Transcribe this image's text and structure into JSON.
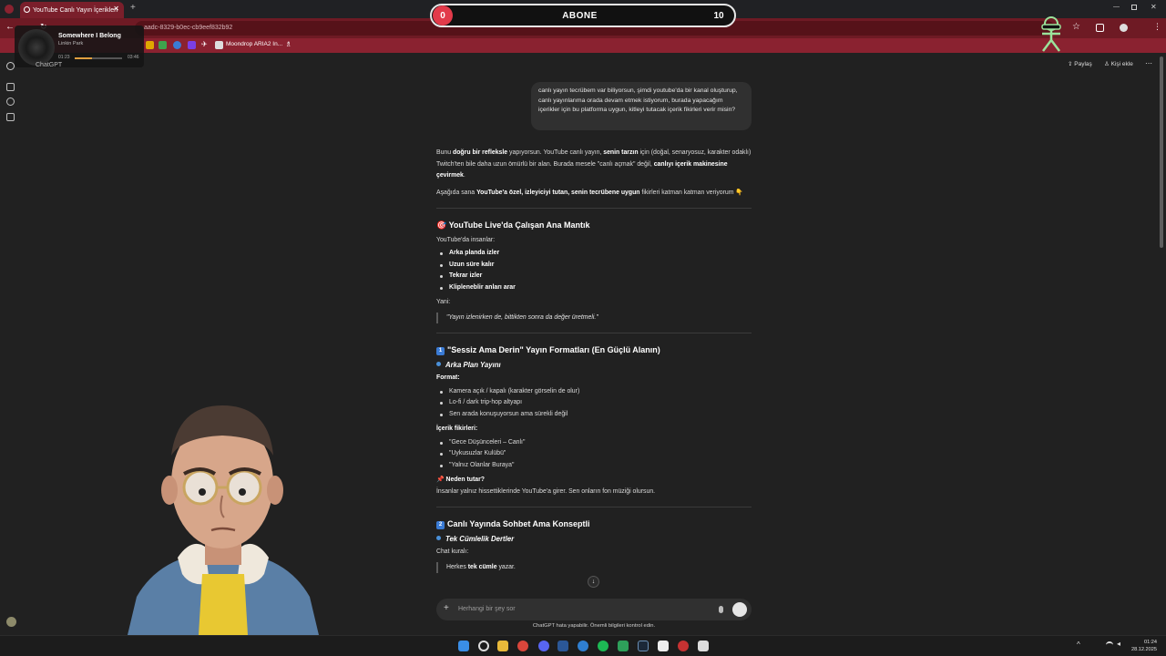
{
  "browser": {
    "tab_title": "YouTube Canlı Yayın İçerikleri",
    "url_fragment": "aadc-8329-b0ec-cb9eef832b92",
    "bookmark_label": "Moondrop ARIA2 In...",
    "window_controls": [
      "minimize-icon",
      "maximize-icon",
      "close-icon"
    ]
  },
  "overlay": {
    "title": "ABONE",
    "current": "0",
    "goal": "10"
  },
  "music": {
    "song": "Somewhere I Belong",
    "artist": "Linkin Park",
    "elapsed": "01:23",
    "duration": "03:46"
  },
  "chat": {
    "app_name": "ChatGPT",
    "share_label": "Paylaş",
    "add_person_label": "Kişi ekle",
    "user_message": "canlı yayın tecrübem var biliyorsun, şimdi youtube'da bir kanal oluşturup, canlı yayınlarıma orada devam etmek istiyorum, burada yapacağım içerikler için bu platforma uygun, kitleyi tutacak içerik fikirleri verir misin?",
    "intro_1": {
      "a": "Bunu ",
      "b1": "doğru bir refleksle",
      "c": " yapıyorsun. YouTube canlı yayın, ",
      "b2": "senin tarzın",
      "d": " için (doğal, senaryosuz, karakter odaklı) Twitch'ten bile daha uzun ömürlü bir alan. Burada mesele \"canlı açmak\" değil, ",
      "b3": "canlıyı içerik makinesine çevirmek",
      "e": "."
    },
    "intro_2": {
      "a": "Aşağıda sana ",
      "b": "YouTube'a özel, izleyiciyi tutan, senin tecrübene uygun",
      "c": " fikirleri katman katman veriyorum 👇"
    },
    "section_1": {
      "emoji": "🎯",
      "title": "YouTube Live'da Çalışan Ana Mantık",
      "lead": "YouTube'da insanlar:",
      "items": [
        "Arka planda izler",
        "Uzun süre kalır",
        "Tekrar izler",
        "Klipleneblir anları arar"
      ],
      "lead2": "Yani:",
      "quote": "\"Yayın izlenirken de, bittikten sonra da değer üretmeli.\""
    },
    "section_2": {
      "number": "1",
      "title": "\"Sessiz Ama Derin\" Yayın Formatları (En Güçlü Alanın)",
      "sub": "Arka Plan Yayını",
      "format_label": "Format:",
      "format_items": [
        "Kamera açık / kapalı (karakter görselin de olur)",
        "Lo-fi / dark trip-hop altyapı",
        "Sen arada konuşuyorsun ama sürekli değil"
      ],
      "ideas_label": "İçerik fikirleri:",
      "ideas": [
        "\"Gece Düşünceleri – Canlı\"",
        "\"Uykusuzlar Kulübü\"",
        "\"Yalnız Olanlar Buraya\""
      ],
      "why_emoji": "📌",
      "why_label": "Neden tutar?",
      "why_text": "İnsanlar yalnız hissettiklerinde YouTube'a girer. Sen onların fon müziği olursun."
    },
    "section_3": {
      "number": "2",
      "title": "Canlı Yayında Sohbet Ama Konseptli",
      "sub": "Tek Cümlelik Dertler",
      "lead": "Chat kuralı:",
      "quote_a": "Herkes ",
      "quote_b": "tek cümle",
      "quote_c": " yazar."
    },
    "composer_placeholder": "Herhangi bir şey sor",
    "footer_note": "ChatGPT hata yapabilir. Önemli bilgileri kontrol edin."
  },
  "taskbar": {
    "time": "01:24",
    "date": "28.12.2025"
  },
  "colors": {
    "accent_red": "#7a1f2b",
    "overlay_red": "#e23a4a",
    "page_bg": "#212121",
    "bubble_bg": "#303030"
  }
}
